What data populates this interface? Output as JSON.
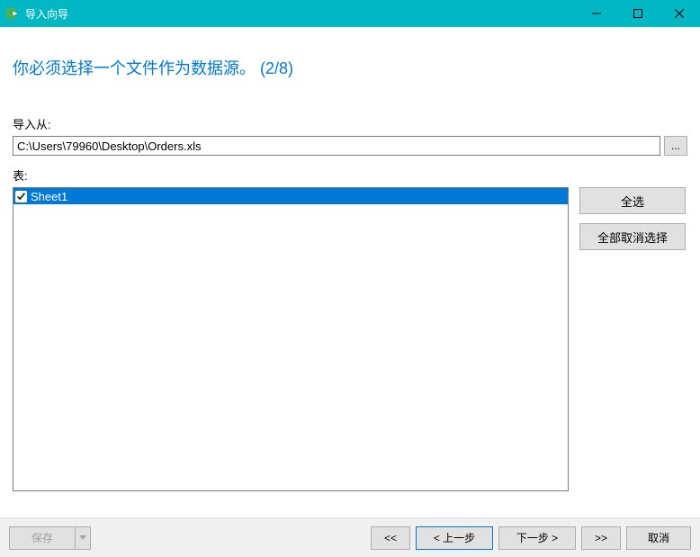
{
  "window": {
    "title": "导入向导"
  },
  "wizard": {
    "heading": "你必须选择一个文件作为数据源。   (2/8)"
  },
  "importFrom": {
    "label": "导入从:",
    "value": "C:\\Users\\79960\\Desktop\\Orders.xls",
    "browse": "..."
  },
  "tables": {
    "label": "表:",
    "items": [
      {
        "name": "Sheet1",
        "checked": true,
        "selected": true
      }
    ],
    "selectAll": "全选",
    "deselectAll": "全部取消选择"
  },
  "footer": {
    "save": "保存",
    "first": "<<",
    "prev": "<  上一步",
    "next": "下一步  >",
    "last": ">>",
    "cancel": "取消"
  }
}
